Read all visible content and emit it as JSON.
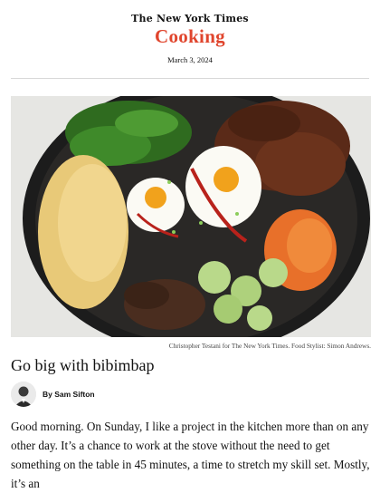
{
  "header": {
    "masthead": "The New York Times",
    "section": "Cooking",
    "date": "March 3, 2024"
  },
  "photo": {
    "subject": "bibimbap-skillet",
    "credit": "Christopher Testani for The New York Times. Food Stylist: Simon Andrews."
  },
  "article": {
    "headline": "Go big with bibimbap",
    "byline": "By Sam Sifton",
    "body": "Good morning. On Sunday, I like a project in the kitchen more than on any other day. It’s a chance to work at the stove without the need to get something on the table in 45 minutes, a time to stretch my skill set. Mostly, it’s an"
  },
  "colors": {
    "brand_red": "#e0452d",
    "text": "#121212",
    "rule": "#d8d8d8"
  }
}
